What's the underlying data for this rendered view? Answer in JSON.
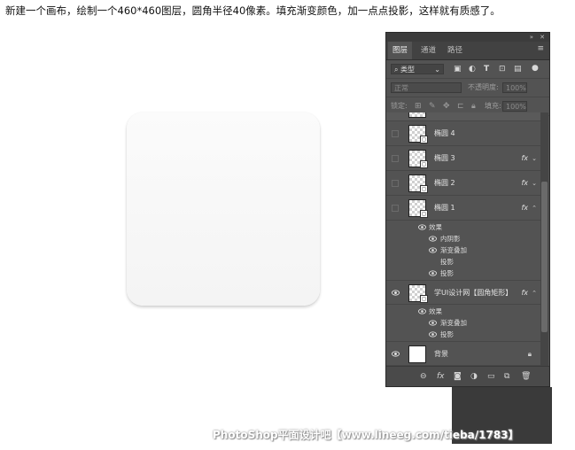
{
  "instruction": "新建一个画布，绘制一个460*460图层，圆角半径40像素。填充渐变颜色，加一点点投影，这样就有质感了。",
  "watermark": "PhotoShop平面设计吧【www.lineeg.com/tieba/1783】",
  "panel": {
    "tabs": [
      "图层",
      "通道",
      "路径"
    ],
    "active_tab": "图层",
    "filter_kind": "类型",
    "blend_mode": "正常",
    "opacity_label": "不透明度:",
    "opacity_value": "100%",
    "lock_label": "锁定:",
    "fill_label": "填充:",
    "fill_value": "100%",
    "layers": [
      {
        "name": "椭圆 4",
        "fx": false,
        "visible": false
      },
      {
        "name": "椭圆 3",
        "fx": true,
        "visible": false
      },
      {
        "name": "椭圆 2",
        "fx": true,
        "visible": false
      },
      {
        "name": "椭圆 1",
        "fx": true,
        "visible": false,
        "expanded": true
      },
      {
        "name": "学UI设计网【圆角矩形】",
        "fx": true,
        "visible": true,
        "expanded": true
      },
      {
        "name": "背景",
        "fx": false,
        "visible": true,
        "locked": true
      }
    ],
    "effects_1": {
      "title": "效果",
      "items": [
        "内阴影",
        "渐变叠加",
        "投影",
        "投影"
      ]
    },
    "effects_2": {
      "title": "效果",
      "items": [
        "渐变叠加",
        "投影"
      ]
    },
    "fx_label": "fx"
  },
  "colors": {
    "panel_bg": "#535353",
    "panel_dark": "#424242",
    "shape_fill": "#f7f7f7"
  },
  "icons": [
    "eye-icon",
    "link-icon",
    "fx-icon",
    "mask-icon",
    "adjustment-icon",
    "folder-icon",
    "new-layer-icon",
    "trash-icon",
    "lock-icon",
    "menu-icon"
  ]
}
